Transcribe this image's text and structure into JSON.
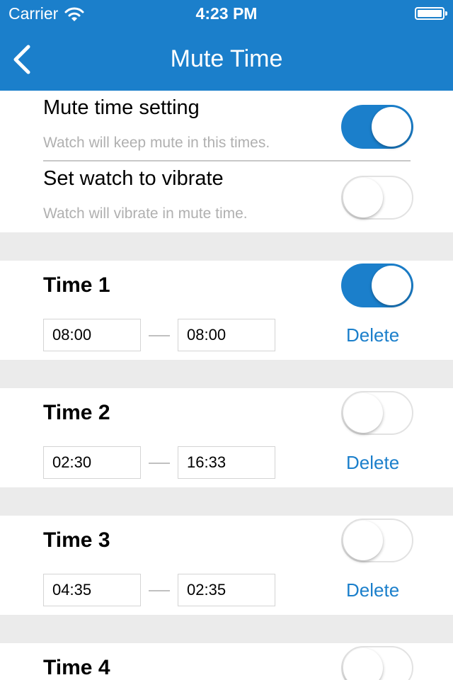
{
  "status_bar": {
    "carrier": "Carrier",
    "time": "4:23 PM"
  },
  "nav": {
    "title": "Mute Time"
  },
  "settings": {
    "mute": {
      "label": "Mute time setting",
      "desc": "Watch will keep mute in this times.",
      "enabled": true
    },
    "vibrate": {
      "label": "Set watch to vibrate",
      "desc": "Watch will vibrate in mute time.",
      "enabled": false
    }
  },
  "times": [
    {
      "title": "Time 1",
      "start": "08:00",
      "end": "08:00",
      "enabled": true,
      "delete_label": "Delete"
    },
    {
      "title": "Time 2",
      "start": "02:30",
      "end": "16:33",
      "enabled": false,
      "delete_label": "Delete"
    },
    {
      "title": "Time 3",
      "start": "04:35",
      "end": "02:35",
      "enabled": false,
      "delete_label": "Delete"
    },
    {
      "title": "Time 4",
      "enabled": false
    }
  ],
  "colors": {
    "accent": "#1b7fcb",
    "separator": "#ebebeb",
    "muted_text": "#b0b0b0"
  }
}
